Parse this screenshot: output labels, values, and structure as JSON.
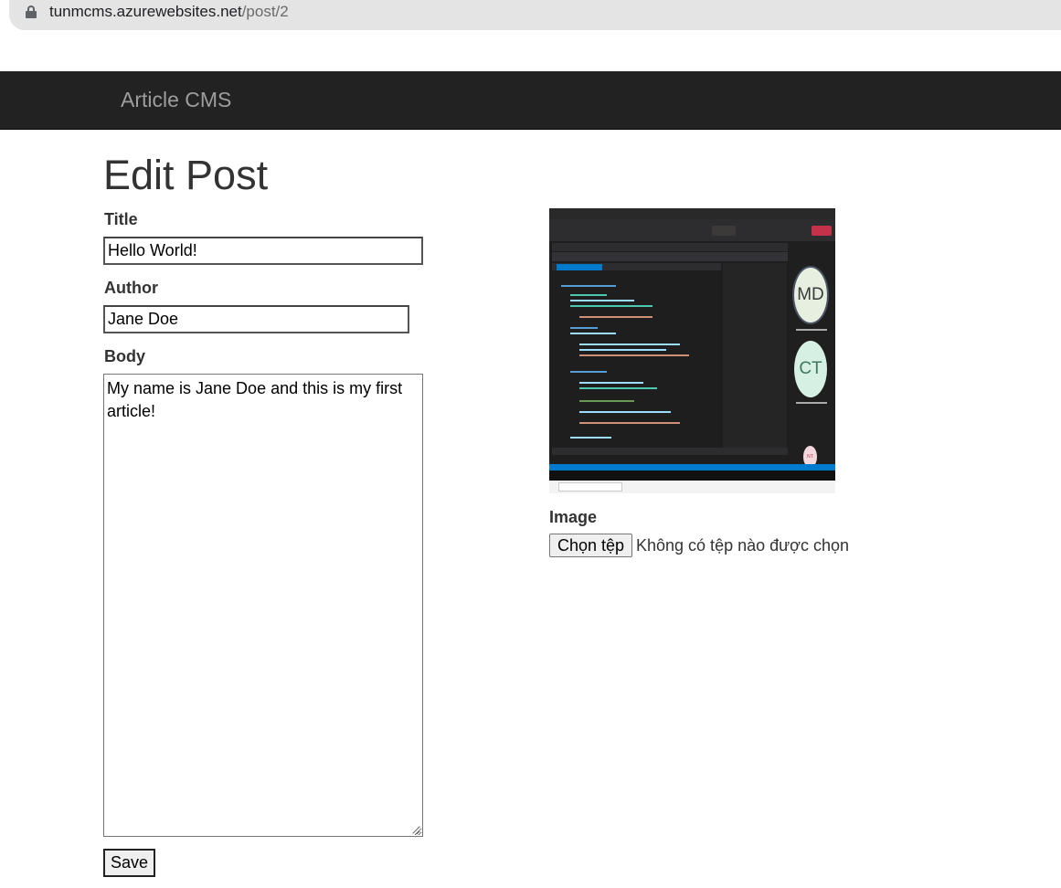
{
  "browser": {
    "url_host": "tunmcms.azurewebsites.net",
    "url_path": "/post/2"
  },
  "navbar": {
    "brand": "Article CMS"
  },
  "page": {
    "title": "Edit Post"
  },
  "form": {
    "title_label": "Title",
    "title_value": "Hello World!",
    "author_label": "Author",
    "author_value": "Jane Doe",
    "body_label": "Body",
    "body_value": "My name is Jane Doe and this is my first article!",
    "save_label": "Save",
    "image_label": "Image",
    "file_button_label": "Chọn tệp",
    "file_status": "Không có tệp nào được chọn"
  },
  "image_preview": {
    "avatars": [
      "MD",
      "CT",
      "NT"
    ]
  },
  "colors": {
    "navbar_bg": "#222222",
    "brand_text": "#9d9d9d",
    "address_bar_bg": "#e4e4e4"
  }
}
